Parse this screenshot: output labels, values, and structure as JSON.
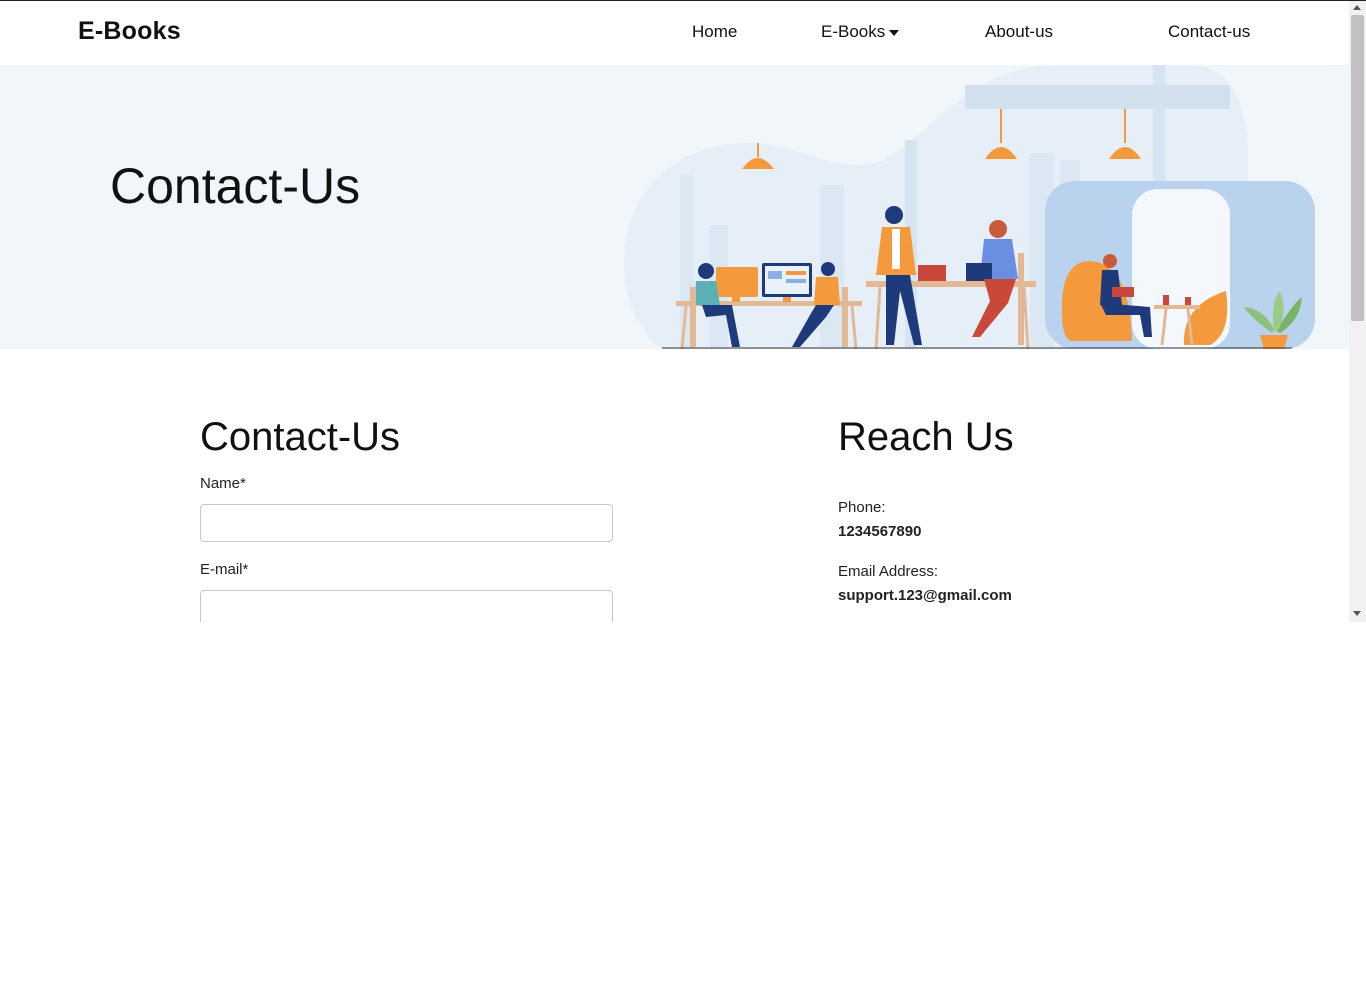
{
  "navbar": {
    "brand": "E-Books",
    "items": [
      {
        "label": "Home"
      },
      {
        "label": "E-Books"
      },
      {
        "label": "About-us"
      },
      {
        "label": "Contact-us"
      }
    ]
  },
  "hero": {
    "title": "Contact-Us",
    "illustration": "office-workspace-illustration"
  },
  "contact_form": {
    "title": "Contact-Us",
    "name_label": "Name*",
    "name_value": "",
    "email_label": "E-mail*",
    "email_value": ""
  },
  "reach_us": {
    "title": "Reach Us",
    "phone_label": "Phone:",
    "phone_value": "1234567890",
    "email_label": "Email Address:",
    "email_value": "support.123@gmail.com"
  },
  "colors": {
    "hero_bg": "#f1f6fa",
    "accent_orange": "#f59a3c",
    "accent_blue": "#1f3a7a",
    "pod_blue": "#b9d3ee"
  }
}
